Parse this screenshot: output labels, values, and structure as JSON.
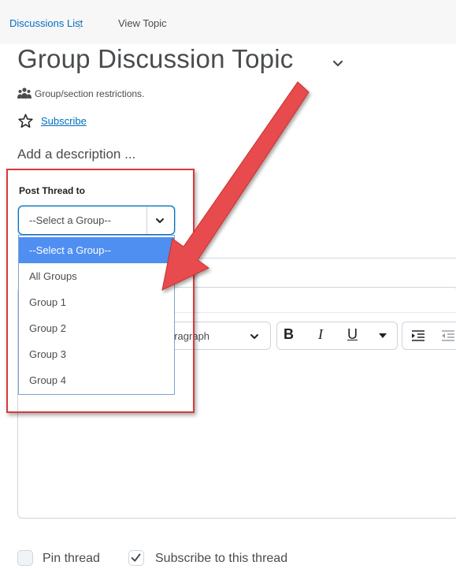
{
  "breadcrumb": {
    "link": "Discussions List",
    "separator": "〉",
    "current": "View Topic"
  },
  "topic": {
    "title": "Group Discussion Topic",
    "restriction_text": "Group/section restrictions.",
    "subscribe_label": "Subscribe",
    "description_placeholder": "Add a description ..."
  },
  "post_form": {
    "post_to_label": "Post Thread to",
    "group_select": {
      "selected": "--Select a Group--",
      "options": [
        "--Select a Group--",
        "All Groups",
        "Group 1",
        "Group 2",
        "Group 3",
        "Group 4"
      ]
    }
  },
  "editor": {
    "format_partial_text": "aragraph",
    "bold": "B",
    "italic": "I",
    "underline": "U"
  },
  "footer": {
    "pin_label": "Pin thread",
    "subscribe_thread_label": "Subscribe to this thread"
  },
  "colors": {
    "link": "#006fbf",
    "selected_option": "#4f8ff2",
    "annotation_red": "#d9393a"
  }
}
